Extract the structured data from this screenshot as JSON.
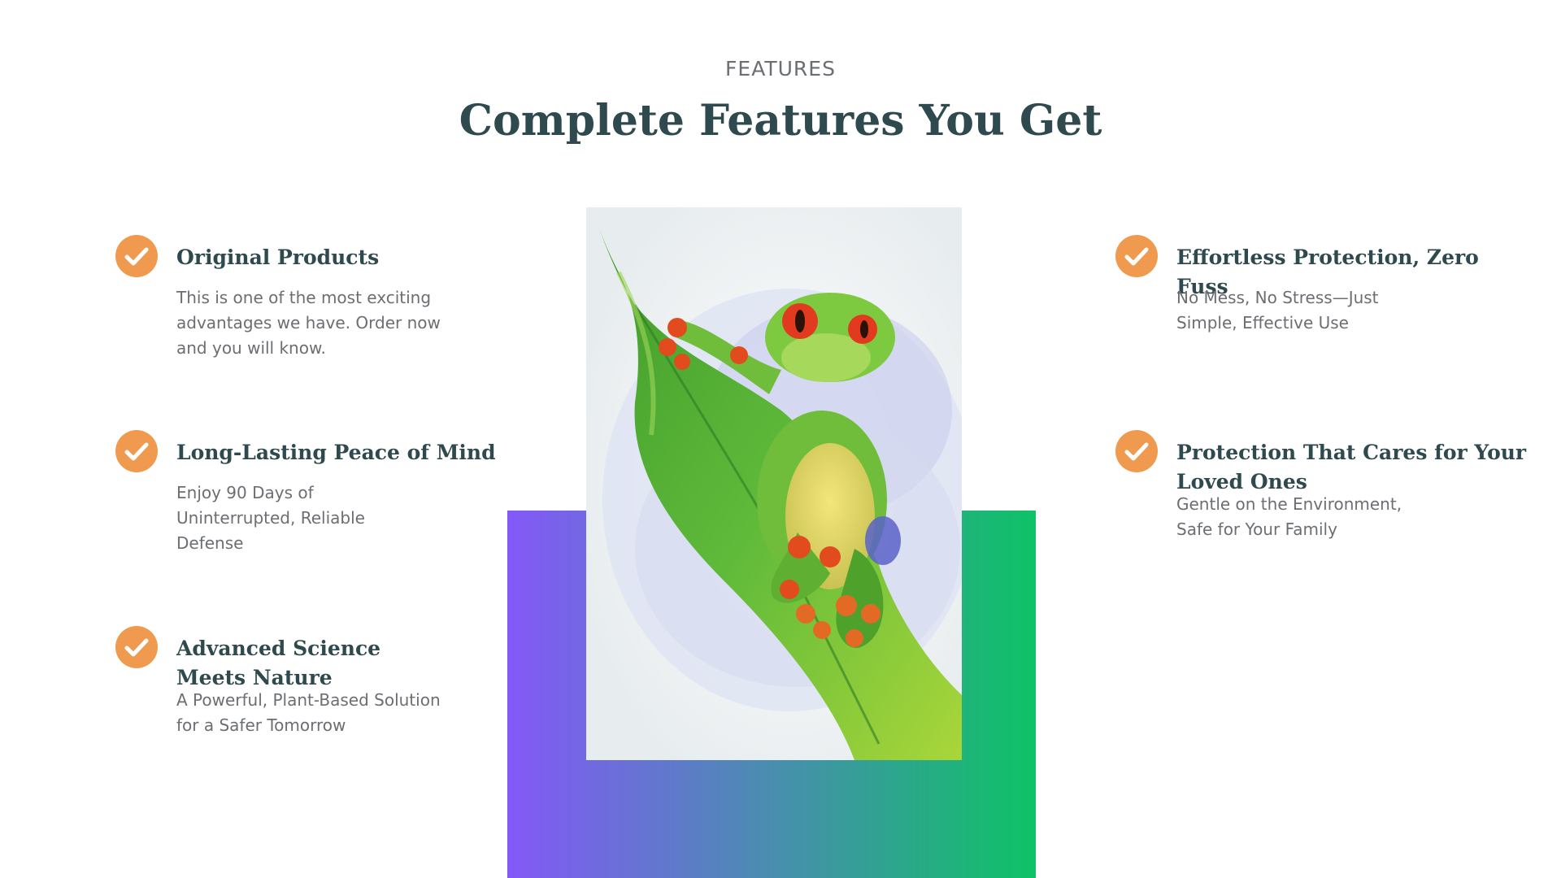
{
  "section": {
    "eyebrow": "FEATURES",
    "title": "Complete Features You Get"
  },
  "features_left": [
    {
      "title": "Original Products",
      "text": "This is one of the most exciting advantages we have. Order now and you will know."
    },
    {
      "title": "Long-Lasting Peace of Mind",
      "text": "Enjoy 90 Days of Uninterrupted, Reliable Defense"
    },
    {
      "title": "Advanced Science Meets Nature",
      "text": "A Powerful, Plant-Based Solution for a Safer Tomorrow"
    }
  ],
  "features_right": [
    {
      "title": "Effortless Protection, Zero Fuss",
      "text": "No Mess, No Stress—Just Simple, Effective Use"
    },
    {
      "title": "Protection That Cares for Your Loved Ones",
      "text": "Gentle on the Environment, Safe for Your Family"
    }
  ],
  "icons": {
    "feature_marker": "check-circle-icon",
    "illustration": "tree-frog-on-leaf"
  },
  "colors": {
    "heading": "#2f4a4e",
    "body_text": "#6b6e72",
    "check_badge": "#ef9a4f",
    "gradient_start": "#8458f8",
    "gradient_end": "#0ec266"
  }
}
